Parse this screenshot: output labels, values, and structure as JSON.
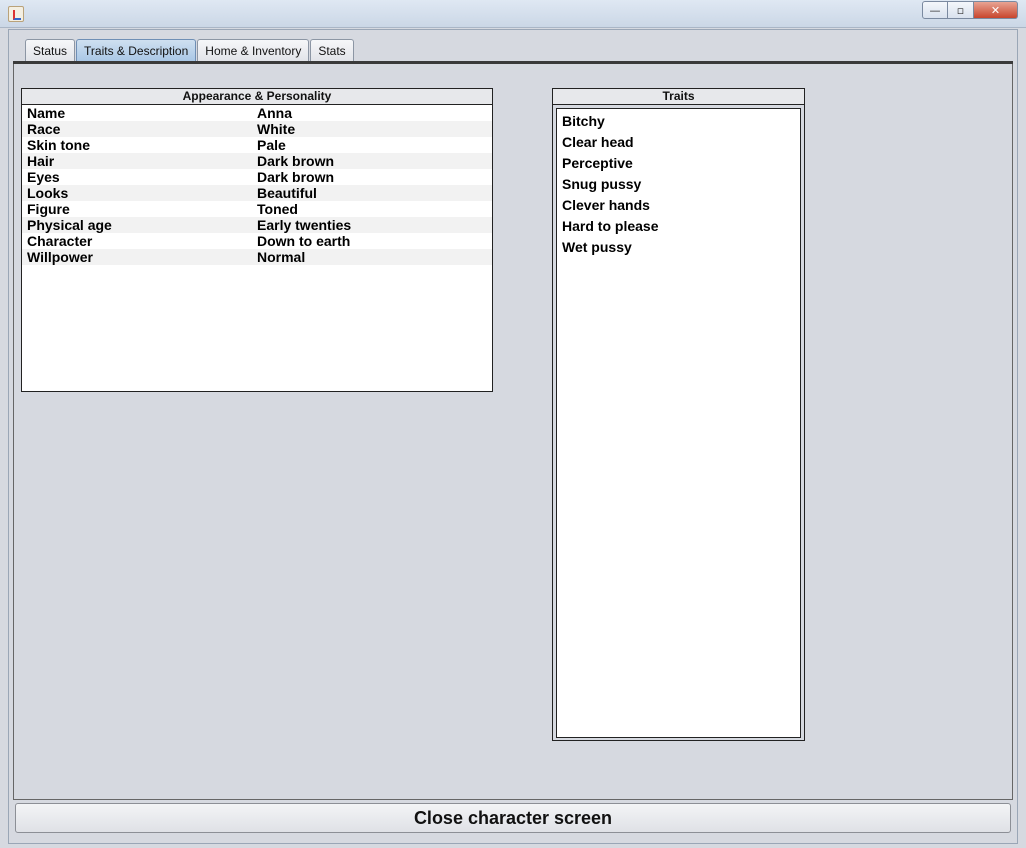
{
  "window": {
    "minimize_label": "—",
    "maximize_label": "▫",
    "close_label": "✕"
  },
  "tabs": [
    {
      "label": "Status"
    },
    {
      "label": "Traits & Description"
    },
    {
      "label": "Home & Inventory"
    },
    {
      "label": "Stats"
    }
  ],
  "appearance": {
    "title": "Appearance & Personality",
    "rows": [
      {
        "label": "Name",
        "value": "Anna"
      },
      {
        "label": "Race",
        "value": "White"
      },
      {
        "label": "Skin tone",
        "value": "Pale"
      },
      {
        "label": "Hair",
        "value": "Dark brown"
      },
      {
        "label": "Eyes",
        "value": "Dark brown"
      },
      {
        "label": "Looks",
        "value": "Beautiful"
      },
      {
        "label": "Figure",
        "value": "Toned"
      },
      {
        "label": "Physical age",
        "value": "Early twenties"
      },
      {
        "label": "Character",
        "value": "Down to earth"
      },
      {
        "label": "Willpower",
        "value": "Normal"
      }
    ]
  },
  "traits": {
    "title": "Traits",
    "items": [
      "Bitchy",
      "Clear head",
      "Perceptive",
      "Snug pussy",
      "Clever hands",
      "Hard to please",
      "Wet pussy"
    ]
  },
  "close_button": {
    "label": "Close character screen"
  }
}
